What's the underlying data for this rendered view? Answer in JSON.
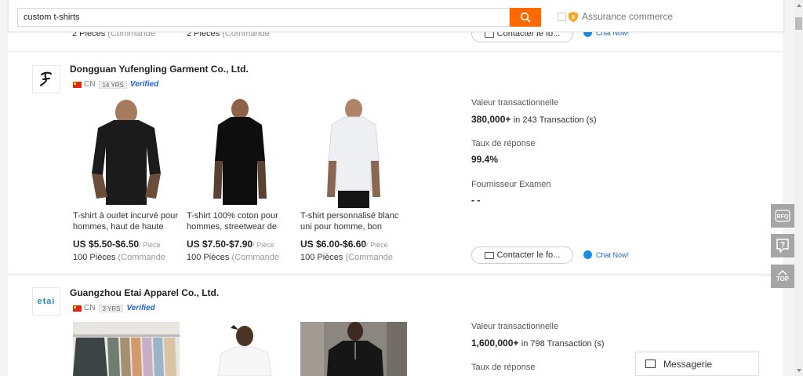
{
  "search": {
    "query": "custom t-shirts",
    "assurance_label": "Assurance commerce"
  },
  "prev_card": {
    "moq1_value": "2 Pièces",
    "moq1_unit": "(Commande",
    "moq2_value": "2 Pièces",
    "moq2_unit": "(Commande",
    "contact_label": "Contacter le fo...",
    "chat_label": "Chat Now!"
  },
  "suppliers": [
    {
      "name": "Dongguan Yufengling Garment Co., Ltd.",
      "country": "CN",
      "years": "14 YRS",
      "verified": "Verified",
      "products": [
        {
          "title": "T-shirt à ourlet incurvé pour hommes, haut de haute",
          "price": "US $5.50-$6.50",
          "unit": "/ Pièce",
          "moq": "100 Pièces",
          "moq_unit": "(Commande"
        },
        {
          "title": "T-shirt 100% coton pour hommes, streetwear de",
          "price": "US $7.50-$7.90",
          "unit": "/ Pièce",
          "moq": "100 Pièces",
          "moq_unit": "(Commande"
        },
        {
          "title": "T-shirt personnalisé blanc uni pour homme, bon",
          "price": "US $6.00-$6.60",
          "unit": "/ Pièce",
          "moq": "100 Pièces",
          "moq_unit": "(Commande"
        }
      ],
      "stats": {
        "transaction_label": "Valeur transactionnelle",
        "transaction_value": "380,000+",
        "transaction_sub": "in 243 Transaction (s)",
        "response_label": "Taux de réponse",
        "response_value": "99.4%",
        "review_label": "Fournisseur Examen",
        "review_value": "- -"
      },
      "contact_label": "Contacter le fo...",
      "chat_label": "Chat Now!"
    },
    {
      "name": "Guangzhou Etai Apparel Co., Ltd.",
      "country": "CN",
      "years": "3 YRS",
      "verified": "Verified",
      "logo_text": "etai",
      "stats": {
        "transaction_label": "Valeur transactionnelle",
        "transaction_value": "1,600,000+",
        "transaction_sub": "in 798 Transaction (s)",
        "response_label": "Taux de réponse"
      }
    }
  ],
  "side_tools": {
    "rfq_label": "RFQ",
    "top_label": "TOP"
  },
  "messagerie_label": "Messagerie",
  "colors": {
    "accent": "#ff6a00",
    "link": "#2264cc",
    "side_tool": "#a6a6a6"
  }
}
